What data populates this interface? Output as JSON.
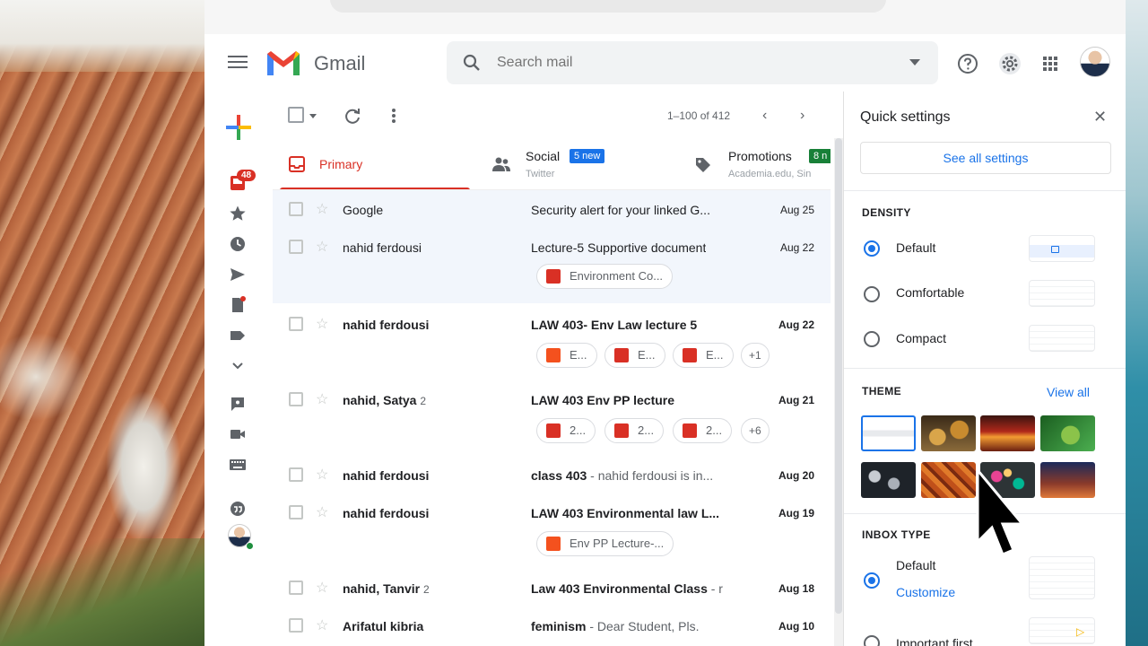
{
  "gmail": {
    "brand": "Gmail",
    "search": {
      "placeholder": "Search mail"
    },
    "rail": {
      "inbox_badge": "48"
    },
    "toolbar": {
      "pager": "1–100 of 412"
    },
    "tabs": [
      {
        "label": "Primary"
      },
      {
        "label": "Social",
        "badge": "5 new",
        "sub": "Twitter"
      },
      {
        "label": "Promotions",
        "badge": "8 n",
        "sub": "Academia.edu, Sin"
      }
    ],
    "rows": [
      {
        "sender": "Google",
        "subject": "Security alert for your linked G...",
        "snippet": "",
        "date": "Aug 25",
        "read": true
      },
      {
        "sender": "nahid ferdousi",
        "subject": "Lecture-5 Supportive document",
        "snippet": "",
        "date": "Aug 22",
        "read": true,
        "chips": [
          {
            "label": "Environment Co...",
            "kind": "pdf"
          }
        ]
      },
      {
        "sender": "nahid ferdousi",
        "subject": "LAW 403- Env Law lecture 5",
        "snippet": "",
        "date": "Aug 22",
        "read": false,
        "chips": [
          {
            "label": "E...",
            "kind": "ppt"
          },
          {
            "label": "E...",
            "kind": "pdf"
          },
          {
            "label": "E...",
            "kind": "pdf"
          }
        ],
        "more": "+1"
      },
      {
        "sender": "nahid, Satya",
        "count": "2",
        "subject": "LAW 403 Env PP lecture",
        "snippet": "",
        "date": "Aug 21",
        "read": false,
        "chips": [
          {
            "label": "2...",
            "kind": "img"
          },
          {
            "label": "2...",
            "kind": "img"
          },
          {
            "label": "2...",
            "kind": "img"
          }
        ],
        "more": "+6"
      },
      {
        "sender": "nahid ferdousi",
        "subject": "class 403",
        "snippet": " - nahid ferdousi is in...",
        "date": "Aug 20",
        "read": false
      },
      {
        "sender": "nahid ferdousi",
        "subject": "LAW 403 Environmental law L...",
        "snippet": "",
        "date": "Aug 19",
        "read": false,
        "chips": [
          {
            "label": "Env PP Lecture-...",
            "kind": "ppt"
          }
        ]
      },
      {
        "sender": "nahid, Tanvir",
        "count": "2",
        "subject": "Law 403 Environmental Class",
        "snippet": " - r",
        "date": "Aug 18",
        "read": false
      },
      {
        "sender": "Arifatul kibria",
        "subject": "feminism",
        "snippet": " - Dear Student, Pls.",
        "date": "Aug 10",
        "read": false
      }
    ]
  },
  "quick_settings": {
    "title": "Quick settings",
    "see_all": "See all settings",
    "density": {
      "heading": "DENSITY",
      "options": [
        "Default",
        "Comfortable",
        "Compact"
      ],
      "selected": "Default"
    },
    "theme": {
      "heading": "THEME",
      "view_all": "View all"
    },
    "inbox_type": {
      "heading": "INBOX TYPE",
      "options": [
        "Default",
        "Important first"
      ],
      "selected": "Default",
      "customize": "Customize"
    }
  },
  "colors": {
    "accent": "#1a73e8",
    "primary_tab": "#d93025",
    "badge": "#1a73e8",
    "online": "#1e8e3e"
  },
  "icons": [
    "menu-icon",
    "search-icon",
    "help-icon",
    "settings-icon",
    "apps-icon",
    "refresh-icon",
    "more-vert-icon",
    "inbox-icon",
    "star-icon",
    "clock-icon",
    "send-icon",
    "draft-icon",
    "label-icon",
    "chevron-down-icon",
    "chat-icon",
    "video-icon",
    "keyboard-icon",
    "hangouts-icon",
    "close-icon"
  ]
}
